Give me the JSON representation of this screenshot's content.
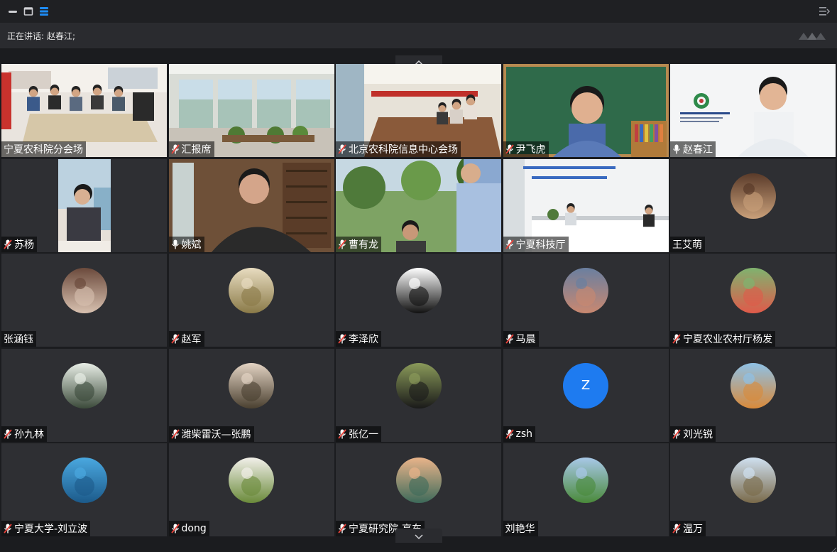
{
  "speaker": {
    "label": "正在讲话:",
    "name": "赵春江;"
  },
  "participants": [
    {
      "name": "宁夏农科院分会场",
      "mic": "none",
      "kind": "video",
      "scene": "conference-room"
    },
    {
      "name": "汇报席",
      "mic": "muted",
      "kind": "video",
      "scene": "window-room"
    },
    {
      "name": "北京农科院信息中心会场",
      "mic": "muted",
      "kind": "video",
      "scene": "long-table"
    },
    {
      "name": "尹飞虎",
      "mic": "muted",
      "kind": "video",
      "scene": "blackboard-person"
    },
    {
      "name": "赵春江",
      "mic": "active",
      "kind": "video",
      "scene": "slide-person",
      "active": true
    },
    {
      "name": "苏杨",
      "mic": "muted",
      "kind": "video",
      "scene": "woman-window"
    },
    {
      "name": "姚斌",
      "mic": "active",
      "kind": "video",
      "scene": "bookshelf-person"
    },
    {
      "name": "曹有龙",
      "mic": "muted",
      "kind": "video",
      "scene": "outdoor-people"
    },
    {
      "name": "宁夏科技厅",
      "mic": "muted",
      "kind": "video",
      "scene": "office-wall"
    },
    {
      "name": "王艾萌",
      "mic": "none",
      "kind": "avatar",
      "color1": "#5a3b2a",
      "color2": "#c9a07a"
    },
    {
      "name": "张涵钰",
      "mic": "none",
      "kind": "avatar",
      "color1": "#6b4a3c",
      "color2": "#d8c1b0"
    },
    {
      "name": "赵军",
      "mic": "muted",
      "kind": "avatar",
      "color1": "#e8dcc0",
      "color2": "#8a7a48"
    },
    {
      "name": "李泽欣",
      "mic": "muted",
      "kind": "avatar",
      "color1": "#ffffff",
      "color2": "#111111"
    },
    {
      "name": "马晨",
      "mic": "muted",
      "kind": "avatar",
      "color1": "#6a7fa0",
      "color2": "#c98870"
    },
    {
      "name": "宁夏农业农村厅杨发",
      "mic": "muted",
      "kind": "avatar",
      "color1": "#7fb36f",
      "color2": "#e05a4a"
    },
    {
      "name": "孙九林",
      "mic": "muted",
      "kind": "avatar",
      "color1": "#e8eee6",
      "color2": "#3b4a3a"
    },
    {
      "name": "潍柴雷沃—张鹏",
      "mic": "muted",
      "kind": "avatar",
      "color1": "#e3d3c3",
      "color2": "#4a4030"
    },
    {
      "name": "张亿一",
      "mic": "muted",
      "kind": "avatar",
      "color1": "#8a9a5a",
      "color2": "#1a1a1a"
    },
    {
      "name": "zsh",
      "mic": "muted",
      "kind": "letter",
      "letter": "Z"
    },
    {
      "name": "刘光锐",
      "mic": "muted",
      "kind": "avatar",
      "color1": "#8ec1e6",
      "color2": "#d98a3a"
    },
    {
      "name": "宁夏大学-刘立波",
      "mic": "muted",
      "kind": "avatar",
      "color1": "#4aa8e0",
      "color2": "#1c5a8a"
    },
    {
      "name": "dong",
      "mic": "muted",
      "kind": "avatar",
      "color1": "#f2f0ea",
      "color2": "#6a8a3a"
    },
    {
      "name": "宁夏研究院-高东",
      "mic": "muted",
      "kind": "avatar",
      "color1": "#e9b48a",
      "color2": "#3d6a5a"
    },
    {
      "name": "刘艳华",
      "mic": "none",
      "kind": "avatar",
      "color1": "#a8c8e8",
      "color2": "#4a8a3a"
    },
    {
      "name": "温万",
      "mic": "muted",
      "kind": "avatar",
      "color1": "#cfe0f0",
      "color2": "#7a6a4a"
    }
  ]
}
